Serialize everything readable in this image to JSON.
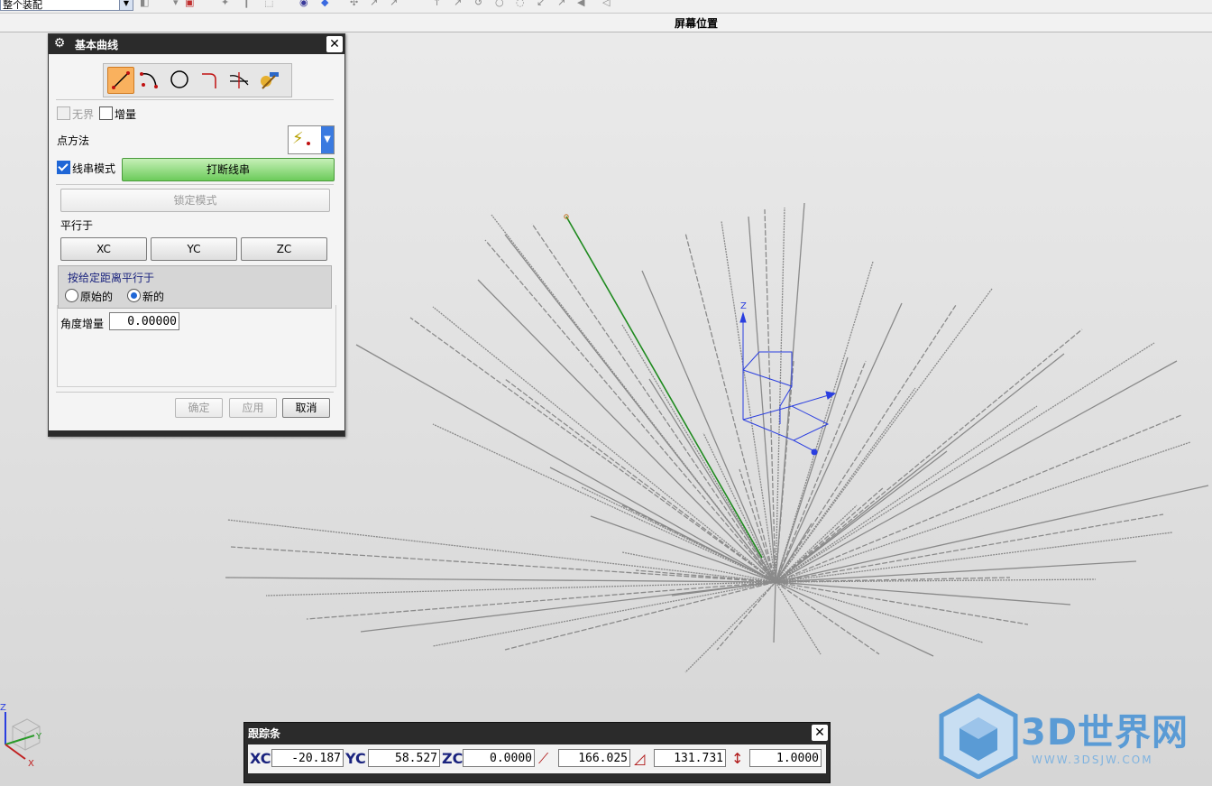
{
  "toolbar": {
    "combo_value": "整个装配"
  },
  "status": {
    "label": "屏幕位置"
  },
  "dialog": {
    "title": "基本曲线",
    "tools": [
      "line-icon",
      "arc-icon",
      "circle-icon",
      "fillet-icon",
      "trim-icon",
      "edit-parameter-icon"
    ],
    "unbounded_label": "无界",
    "increment_label": "增量",
    "point_method_label": "点方法",
    "string_mode_label": "线串模式",
    "break_string_label": "打断线串",
    "lock_mode_label": "锁定模式",
    "parallel_to_label": "平行于",
    "xc_label": "XC",
    "yc_label": "YC",
    "zc_label": "ZC",
    "offset_group_label": "按给定距离平行于",
    "original_label": "原始的",
    "new_label": "新的",
    "angle_inc_label": "角度增量",
    "angle_inc_value": "0.00000",
    "ok_label": "确定",
    "apply_label": "应用",
    "cancel_label": "取消",
    "string_mode_checked": true,
    "new_selected": true
  },
  "trackbar": {
    "title": "跟踪条",
    "xc_label": "XC",
    "xc_value": "-20.187",
    "yc_label": "YC",
    "yc_value": "58.527",
    "zc_label": "ZC",
    "zc_value": "0.0000",
    "length_value": "166.025",
    "angle_value": "131.731",
    "offset_value": "1.0000"
  },
  "wcs": {
    "z_label": "Z",
    "y_label": "Y",
    "x_label": "X"
  },
  "triad": {
    "z_label": "Z",
    "y_label": "Y",
    "x_label": "X"
  },
  "watermark": {
    "brand": "3D世界网",
    "url": "WWW.3DSJW.COM"
  },
  "colors": {
    "line_gray": "#8a8a8a",
    "line_green": "#1f8a1f",
    "wcs_blue": "#2a3ee0",
    "title_bar": "#2b2b2b"
  }
}
